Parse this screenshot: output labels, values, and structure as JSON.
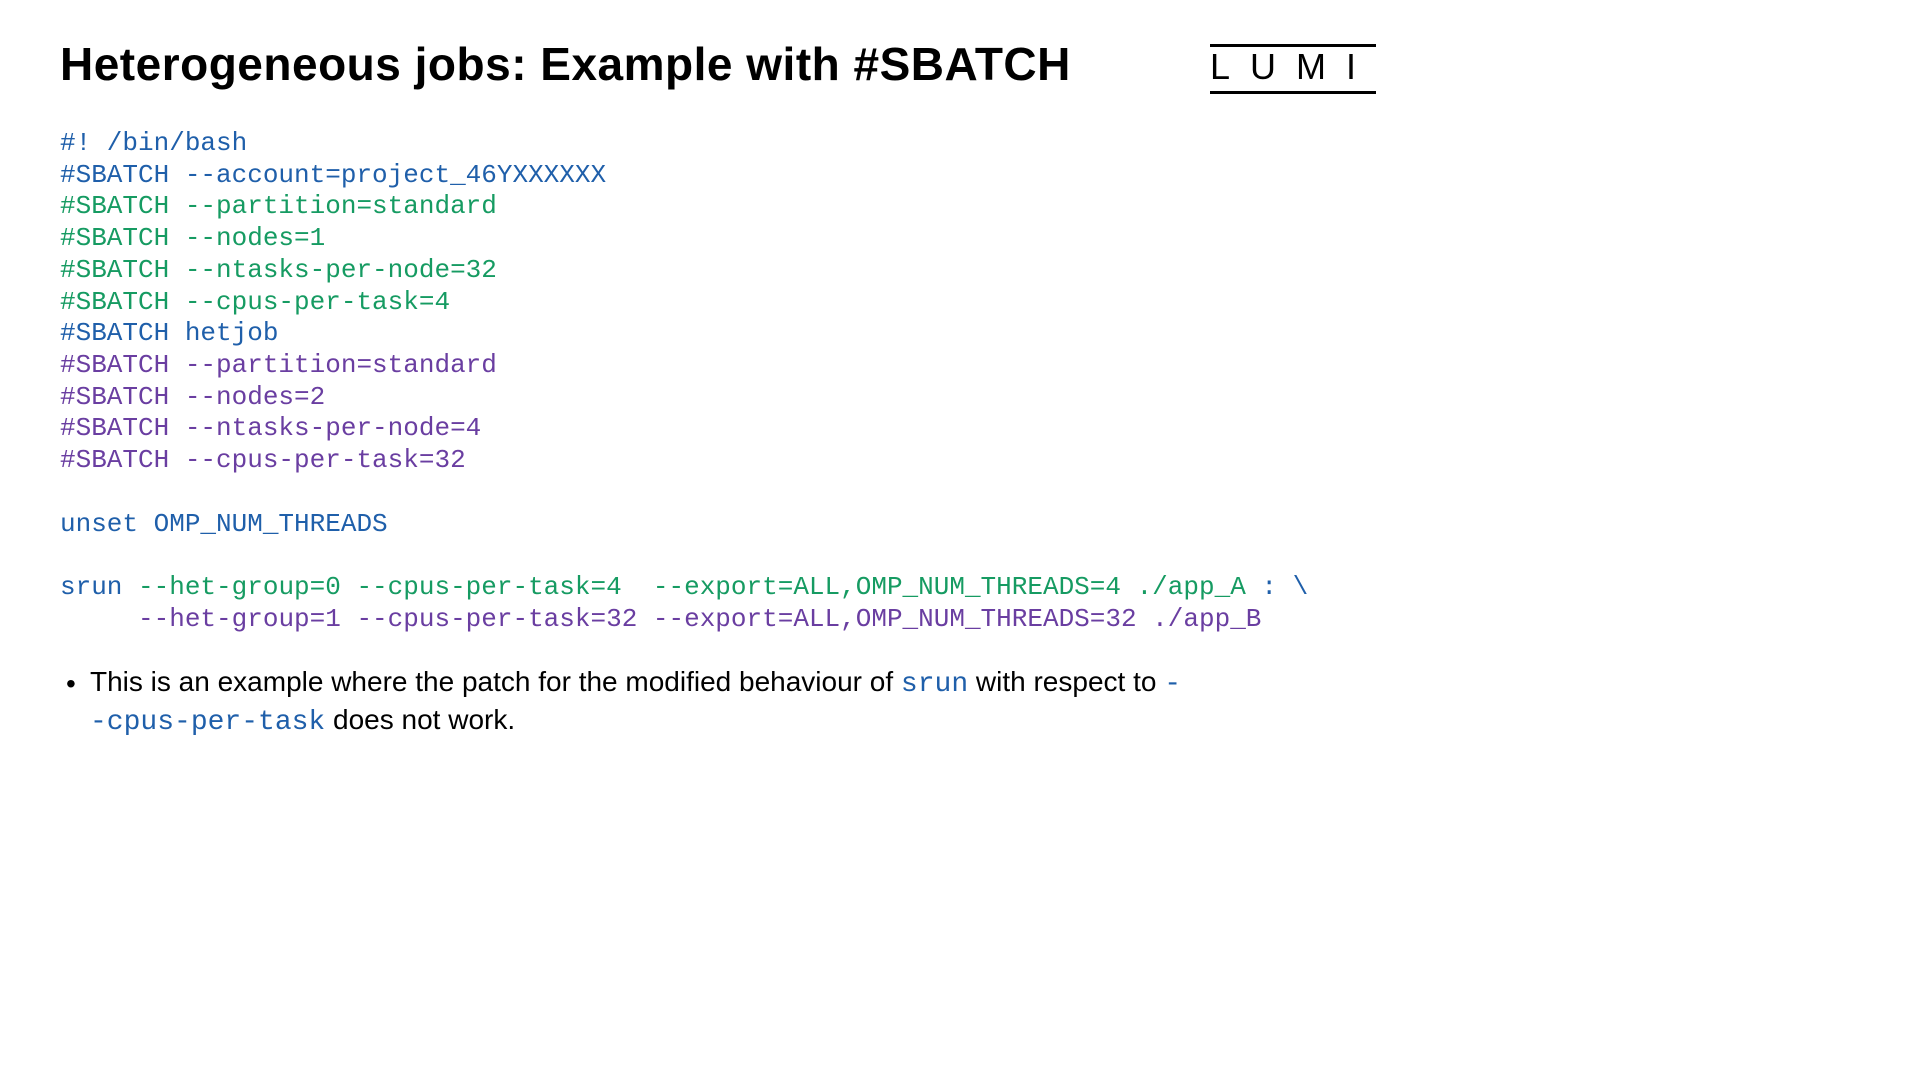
{
  "header": {
    "title": "Heterogeneous jobs: Example with #SBATCH",
    "logo": "LUMI"
  },
  "code": {
    "l01": "#! /bin/bash",
    "l02": "#SBATCH --account=project_46YXXXXXX",
    "l03": "#SBATCH --partition=standard",
    "l04": "#SBATCH --nodes=1",
    "l05": "#SBATCH --ntasks-per-node=32",
    "l06": "#SBATCH --cpus-per-task=4",
    "l07": "#SBATCH hetjob",
    "l08": "#SBATCH --partition=standard",
    "l09": "#SBATCH --nodes=2",
    "l10": "#SBATCH --ntasks-per-node=4",
    "l11": "#SBATCH --cpus-per-task=32",
    "l12": "",
    "l13": "unset OMP_NUM_THREADS",
    "l14": "",
    "l15a": "srun ",
    "l15b": "--het-group=0 --cpus-per-task=4  --export=ALL,OMP_NUM_THREADS=4 ./app_A",
    "l15c": " : \\",
    "l16a": "     ",
    "l16b": "--het-group=1 --cpus-per-task=32 --export=ALL,OMP_NUM_THREADS=32 ./app_B"
  },
  "note": {
    "bullet": "•",
    "t1": "This is an example where the patch for the modified behaviour of ",
    "srun": "srun",
    "t2": " with respect to ",
    "flag1": " -",
    "flag2": "-cpus-per-task",
    "t3": " does not work."
  }
}
